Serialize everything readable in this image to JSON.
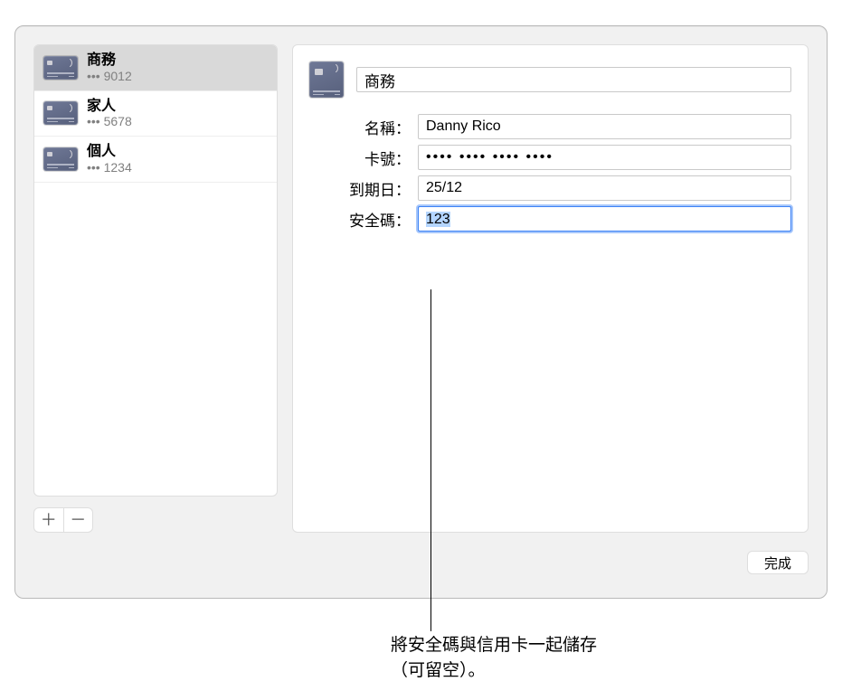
{
  "sidebar": {
    "items": [
      {
        "title": "商務",
        "mask": "••• 9012",
        "selected": true
      },
      {
        "title": "家人",
        "mask": "••• 5678",
        "selected": false
      },
      {
        "title": "個人",
        "mask": "••• 1234",
        "selected": false
      }
    ],
    "add_glyph": "＋",
    "remove_glyph": "－"
  },
  "detail": {
    "title_value": "商務",
    "labels": {
      "name": "名稱：",
      "number": "卡號：",
      "expiry": "到期日：",
      "cvv": "安全碼："
    },
    "values": {
      "name": "Danny Rico",
      "number_masked": "•••• •••• •••• ••••",
      "expiry": "25/12",
      "cvv": "123"
    }
  },
  "buttons": {
    "done": "完成"
  },
  "callout": {
    "line1": "將安全碼與信用卡一起儲存",
    "line2": "（可留空）。"
  }
}
